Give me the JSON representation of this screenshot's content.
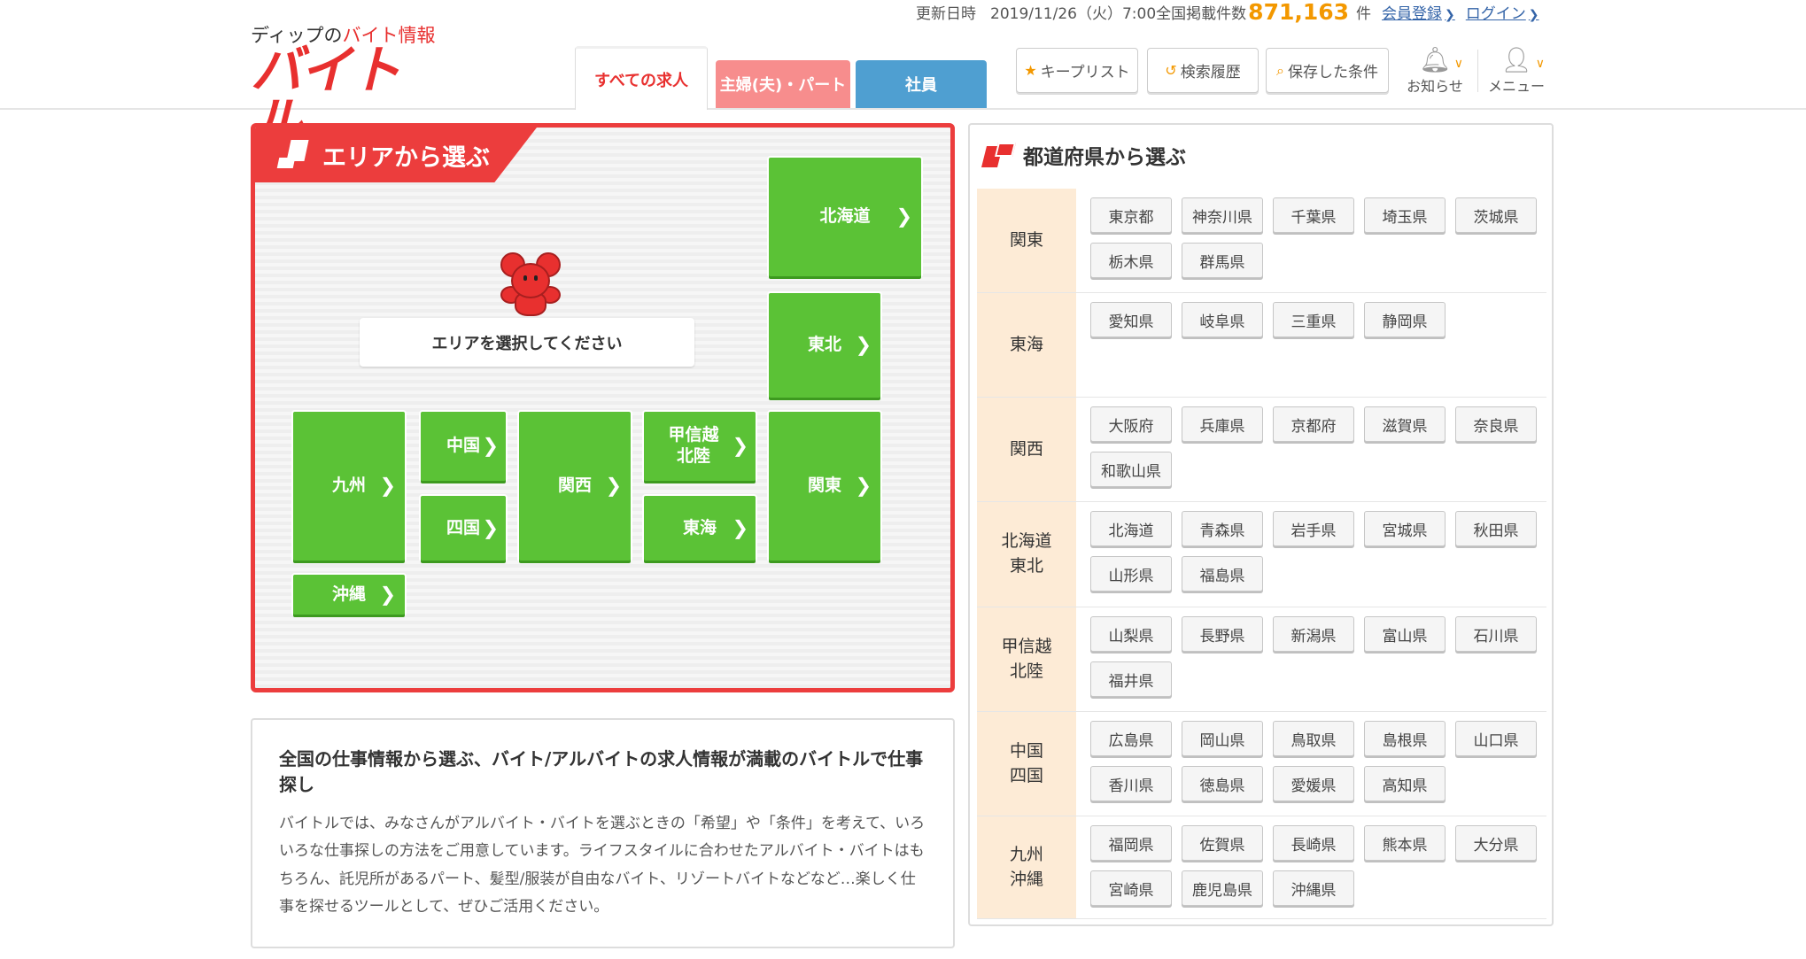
{
  "header": {
    "logo_tagline_prefix": "ディップの",
    "logo_tagline_highlight": "バイト情報",
    "logo_text": "バイトル",
    "updated_label": "更新日時",
    "updated_value": "2019/11/26（火）7:00",
    "count_label": "全国掲載件数",
    "count_value": "871,163",
    "count_unit": "件",
    "register_link": "会員登録",
    "login_link": "ログイン",
    "tabs": [
      {
        "label": "すべての求人",
        "active": true
      },
      {
        "label": "主婦(夫)・パート",
        "color": "#f78d8d"
      },
      {
        "label": "社員",
        "color": "#4f9fd1"
      }
    ],
    "keep_list": "キープリスト",
    "search_history": "検索履歴",
    "saved_conditions": "保存した条件",
    "notice": "お知らせ",
    "menu": "メニュー"
  },
  "area": {
    "title": "エリアから選ぶ",
    "prompt": "エリアを選択してください",
    "regions": {
      "hokkaido": "北海道",
      "tohoku": "東北",
      "kanto": "関東",
      "koshinetsu": "甲信越\n北陸",
      "tokai": "東海",
      "kansai": "関西",
      "chugoku": "中国",
      "shikoku": "四国",
      "kyushu": "九州",
      "okinawa": "沖縄"
    },
    "accent_color": "#ec3d3d",
    "region_color": "#5bc236"
  },
  "description": {
    "title": "全国の仕事情報から選ぶ、バイト/アルバイトの求人情報が満載のバイトルで仕事探し",
    "body": "バイトルでは、みなさんがアルバイト・バイトを選ぶときの「希望」や「条件」を考えて、いろいろな仕事探しの方法をご用意しています。ライフスタイルに合わせたアルバイト・バイトはもちろん、託児所があるパート、髪型/服装が自由なバイト、リゾートバイトなどなど…楽しく仕事を探せるツールとして、ぜひご活用ください。"
  },
  "prefectures": {
    "title": "都道府県から選ぶ",
    "rows": [
      {
        "label": "関東",
        "items": [
          "東京都",
          "神奈川県",
          "千葉県",
          "埼玉県",
          "茨城県",
          "栃木県",
          "群馬県"
        ]
      },
      {
        "label": "東海",
        "items": [
          "愛知県",
          "岐阜県",
          "三重県",
          "静岡県"
        ]
      },
      {
        "label": "関西",
        "items": [
          "大阪府",
          "兵庫県",
          "京都府",
          "滋賀県",
          "奈良県",
          "和歌山県"
        ]
      },
      {
        "label": "北海道\n東北",
        "items": [
          "北海道",
          "青森県",
          "岩手県",
          "宮城県",
          "秋田県",
          "山形県",
          "福島県"
        ]
      },
      {
        "label": "甲信越\n北陸",
        "items": [
          "山梨県",
          "長野県",
          "新潟県",
          "富山県",
          "石川県",
          "福井県"
        ]
      },
      {
        "label": "中国\n四国",
        "items": [
          "広島県",
          "岡山県",
          "鳥取県",
          "島根県",
          "山口県",
          "香川県",
          "徳島県",
          "愛媛県",
          "高知県"
        ]
      },
      {
        "label": "九州\n沖縄",
        "items": [
          "福岡県",
          "佐賀県",
          "長崎県",
          "熊本県",
          "大分県",
          "宮崎県",
          "鹿児島県",
          "沖縄県"
        ]
      }
    ]
  }
}
